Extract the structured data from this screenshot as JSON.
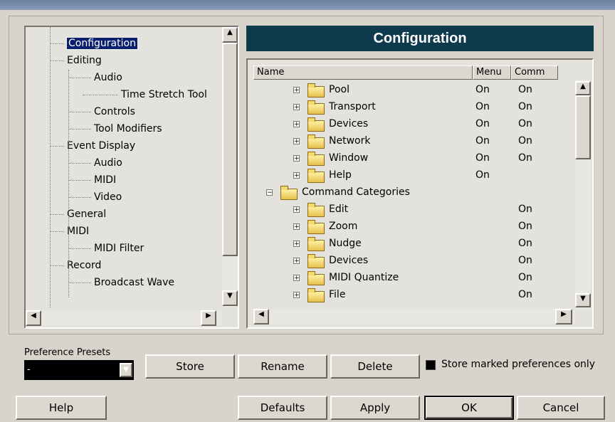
{
  "tree": {
    "items": [
      {
        "label": "Configuration",
        "level": 0,
        "selected": true
      },
      {
        "label": "Editing",
        "level": 0
      },
      {
        "label": "Audio",
        "level": 1
      },
      {
        "label": "Time Stretch Tool",
        "level": 2
      },
      {
        "label": "Controls",
        "level": 1
      },
      {
        "label": "Tool Modifiers",
        "level": 1
      },
      {
        "label": "Event Display",
        "level": 0
      },
      {
        "label": "Audio",
        "level": 1
      },
      {
        "label": "MIDI",
        "level": 1
      },
      {
        "label": "Video",
        "level": 1
      },
      {
        "label": "General",
        "level": 0
      },
      {
        "label": "MIDI",
        "level": 0
      },
      {
        "label": "MIDI Filter",
        "level": 1
      },
      {
        "label": "Record",
        "level": 0
      },
      {
        "label": "Broadcast Wave",
        "level": 1
      }
    ]
  },
  "panel": {
    "title": "Configuration",
    "columns": {
      "name": "Name",
      "menu": "Menu",
      "comm": "Comm"
    },
    "rows": [
      {
        "name": "Pool",
        "menu": "On",
        "comm": "On",
        "depth": 1
      },
      {
        "name": "Transport",
        "menu": "On",
        "comm": "On",
        "depth": 1
      },
      {
        "name": "Devices",
        "menu": "On",
        "comm": "On",
        "depth": 1
      },
      {
        "name": "Network",
        "menu": "On",
        "comm": "On",
        "depth": 1
      },
      {
        "name": "Window",
        "menu": "On",
        "comm": "On",
        "depth": 1
      },
      {
        "name": "Help",
        "menu": "On",
        "comm": "",
        "depth": 1
      },
      {
        "name": "Command Categories",
        "menu": "",
        "comm": "",
        "depth": 0
      },
      {
        "name": "Edit",
        "menu": "",
        "comm": "On",
        "depth": 1
      },
      {
        "name": "Zoom",
        "menu": "",
        "comm": "On",
        "depth": 1
      },
      {
        "name": "Nudge",
        "menu": "",
        "comm": "On",
        "depth": 1
      },
      {
        "name": "Devices",
        "menu": "",
        "comm": "On",
        "depth": 1
      },
      {
        "name": "MIDI Quantize",
        "menu": "",
        "comm": "On",
        "depth": 1
      },
      {
        "name": "File",
        "menu": "",
        "comm": "On",
        "depth": 1
      }
    ]
  },
  "presets": {
    "label": "Preference Presets",
    "value": "-"
  },
  "buttons": {
    "store": "Store",
    "rename": "Rename",
    "delete": "Delete",
    "help": "Help",
    "defaults": "Defaults",
    "apply": "Apply",
    "ok": "OK",
    "cancel": "Cancel"
  },
  "checkbox": {
    "label": "Store marked preferences only",
    "checked": true
  },
  "icons": {
    "folder": "folder-icon",
    "expand": "plus-expand-icon",
    "collapse": "minus-collapse-icon"
  },
  "colors": {
    "title_bg": "#0f3a4e",
    "selection_bg": "#0a1f6e",
    "window_bg": "#d8d4cc"
  }
}
